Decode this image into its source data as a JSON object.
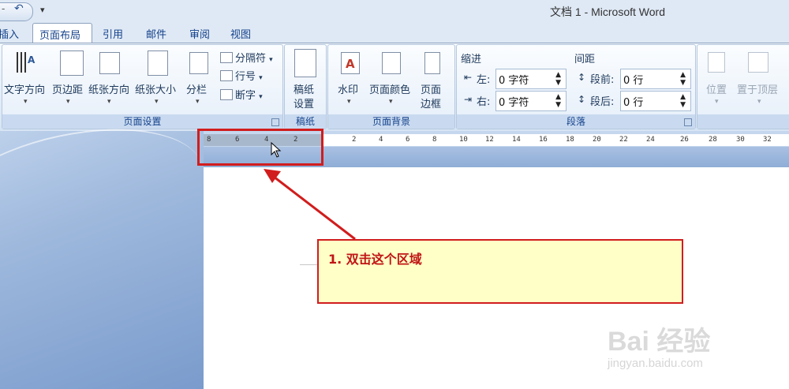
{
  "window": {
    "title": "文档 1 - Microsoft Word"
  },
  "tabs": [
    {
      "label": "插入"
    },
    {
      "label": "页面布局"
    },
    {
      "label": "引用"
    },
    {
      "label": "邮件"
    },
    {
      "label": "审阅"
    },
    {
      "label": "视图"
    }
  ],
  "ribbon": {
    "page_setup": {
      "label": "页面设置",
      "text_direction": "文字方向",
      "margins": "页边距",
      "orientation": "纸张方向",
      "size": "纸张大小",
      "columns": "分栏",
      "breaks": "分隔符",
      "line_numbers": "行号",
      "hyphenation": "断字"
    },
    "manuscript": {
      "label": "稿纸",
      "button_line1": "稿纸",
      "button_line2": "设置"
    },
    "page_background": {
      "label": "页面背景",
      "watermark": "水印",
      "page_color": "页面颜色",
      "border_line1": "页面",
      "border_line2": "边框"
    },
    "paragraph": {
      "label": "段落",
      "indent_title": "缩进",
      "spacing_title": "间距",
      "left_label": "左:",
      "right_label": "右:",
      "left_value": "0 字符",
      "right_value": "0 字符",
      "before_label": "段前:",
      "after_label": "段后:",
      "before_value": "0 行",
      "after_value": "0 行"
    },
    "arrange": {
      "position": "位置",
      "bring_front": "置于顶层"
    }
  },
  "ruler": {
    "left_ticks": [
      "8",
      "6",
      "4",
      "2"
    ],
    "right_ticks": [
      "2",
      "4",
      "6",
      "8",
      "10",
      "12",
      "14",
      "16",
      "18",
      "20",
      "22",
      "24",
      "26",
      "28",
      "30",
      "32"
    ]
  },
  "callout": {
    "text": "1. 双击这个区域"
  },
  "watermark": {
    "brand": "Bai 经验",
    "url": "jingyan.baidu.com"
  },
  "colors": {
    "highlight": "#d11d1d",
    "callout_bg": "#ffffc8",
    "ribbon_text": "#15428b"
  }
}
